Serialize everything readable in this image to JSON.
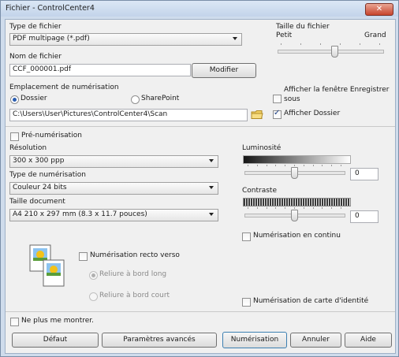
{
  "window": {
    "title": "Fichier - ControlCenter4",
    "close_label": "✕"
  },
  "file_type": {
    "label": "Type de fichier",
    "value": "PDF multipage (*.pdf)"
  },
  "file_size": {
    "label": "Taille du fichier",
    "small": "Petit",
    "large": "Grand",
    "level": 0.55
  },
  "file_name": {
    "label": "Nom de fichier",
    "value": "CCF_000001.pdf",
    "modify_label": "Modifier"
  },
  "scan_location": {
    "label": "Emplacement de numérisation",
    "folder_label": "Dossier",
    "sharepoint_label": "SharePoint",
    "path": "C:\\Users\\User\\Pictures\\ControlCenter4\\Scan",
    "selected": "folder"
  },
  "show_save_window": {
    "label_line1": "Afficher la fenêtre Enregistrer",
    "label_line2": "sous",
    "checked": false
  },
  "show_folder": {
    "label": "Afficher Dossier",
    "checked": true
  },
  "prescan": {
    "label": "Pré-numérisation",
    "checked": false
  },
  "resolution": {
    "label": "Résolution",
    "value": "300 x 300 ppp"
  },
  "scan_type": {
    "label": "Type de numérisation",
    "value": "Couleur 24 bits"
  },
  "document_size": {
    "label": "Taille document",
    "value": "A4 210 x 297 mm (8.3 x 11.7 pouces)"
  },
  "brightness": {
    "label": "Luminosité",
    "value": "0",
    "level": 0.5
  },
  "contrast": {
    "label": "Contraste",
    "value": "0",
    "level": 0.5
  },
  "continuous_scan": {
    "label": "Numérisation en continu",
    "checked": false
  },
  "duplex": {
    "label": "Numérisation recto verso",
    "checked": false,
    "long_edge_label": "Reliure à bord long",
    "short_edge_label": "Reliure à bord court",
    "selected": "long"
  },
  "id_card_scan": {
    "label": "Numérisation de carte d'identité",
    "checked": false
  },
  "dont_show": {
    "label": "Ne plus me montrer.",
    "checked": false
  },
  "buttons": {
    "default": "Défaut",
    "advanced": "Paramètres avancés",
    "scan": "Numérisation",
    "cancel": "Annuler",
    "help": "Aide"
  },
  "colors": {
    "title_bar": "#c8d8ec",
    "close_button": "#c7442c",
    "accent": "#2a5db0"
  },
  "icons": {
    "folder": "folder-icon",
    "duplex": "duplex-pages-icon",
    "close": "close-icon"
  }
}
